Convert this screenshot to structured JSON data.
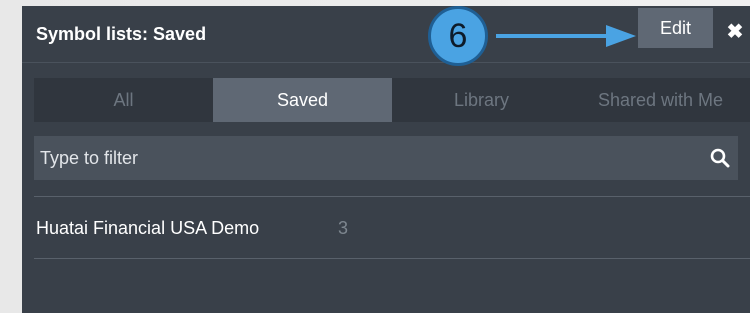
{
  "panel": {
    "title": "Symbol lists: Saved",
    "edit_label": "Edit",
    "close_glyph": "✖"
  },
  "callout": {
    "number": "6"
  },
  "tabs": [
    {
      "label": "All",
      "active": false
    },
    {
      "label": "Saved",
      "active": true
    },
    {
      "label": "Library",
      "active": false
    },
    {
      "label": "Shared with Me",
      "active": false
    }
  ],
  "filter": {
    "placeholder": "Type to filter",
    "value": ""
  },
  "lists": [
    {
      "name": "Huatai Financial USA Demo",
      "count": "3"
    }
  ],
  "colors": {
    "panel_bg": "#394049",
    "active_tab": "#5f6874",
    "callout_blue": "#4aa3e3"
  }
}
